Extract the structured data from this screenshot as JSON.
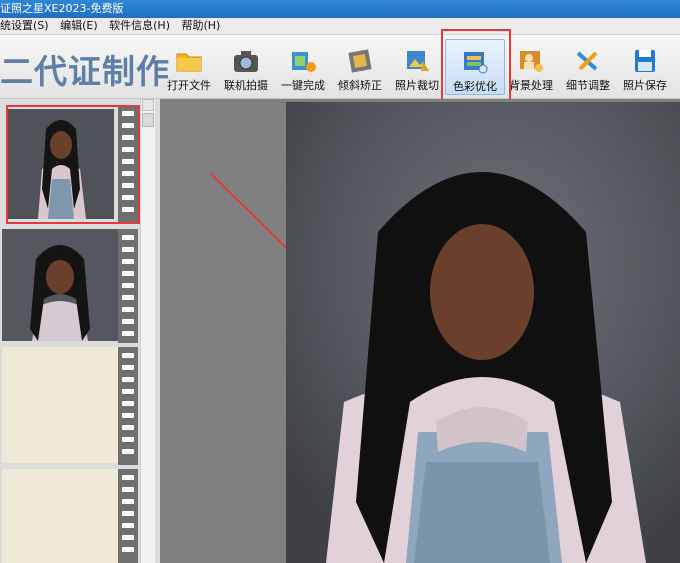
{
  "window": {
    "title": "证照之星XE2023-免费版"
  },
  "menu": {
    "items": [
      "统设置(S)",
      "编辑(E)",
      "软件信息(H)",
      "帮助(H)"
    ]
  },
  "brand": {
    "text": "二代证制作"
  },
  "toolbar": {
    "buttons": [
      {
        "label": "打开文件",
        "icon": "folder-icon",
        "color": "#f2b51f"
      },
      {
        "label": "联机拍摄",
        "icon": "camera-icon",
        "color": "#555555"
      },
      {
        "label": "一键完成",
        "icon": "magic-icon",
        "color": "#f39c12"
      },
      {
        "label": "倾斜矫正",
        "icon": "tilt-correct-icon",
        "color": "#777777"
      },
      {
        "label": "照片裁切",
        "icon": "crop-icon",
        "color": "#e0a21a"
      },
      {
        "label": "色彩优化",
        "icon": "color-optimize-icon",
        "color": "#3a78c8",
        "active": true
      },
      {
        "label": "背景处理",
        "icon": "background-icon",
        "color": "#d98a2b"
      },
      {
        "label": "细节调整",
        "icon": "detail-adjust-icon",
        "color": "#2f8fd6"
      },
      {
        "label": "照片保存",
        "icon": "save-icon",
        "color": "#1f7bd1"
      }
    ]
  },
  "thumbnails": [
    {
      "state": "selected"
    },
    {
      "state": "normal"
    },
    {
      "state": "empty"
    },
    {
      "state": "empty"
    }
  ],
  "colors": {
    "highlight": "#e23b3b",
    "brand": "#5f7ea8",
    "titlebar": "#1f6fc2"
  }
}
